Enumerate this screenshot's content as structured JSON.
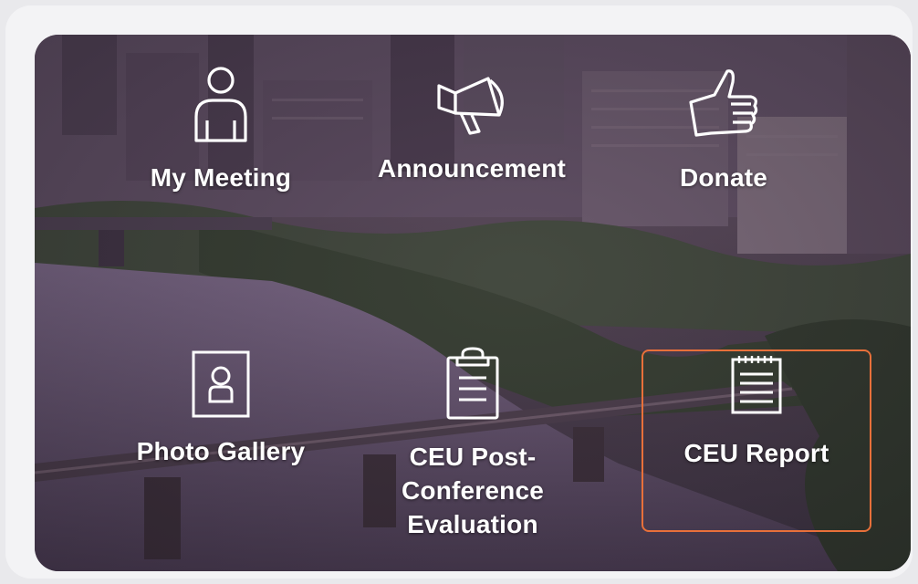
{
  "theme": {
    "accent": "#e8703a",
    "tile_text": "#ffffff"
  },
  "tiles": [
    {
      "id": "my-meeting",
      "label": "My Meeting",
      "icon": "person-icon"
    },
    {
      "id": "announcement",
      "label": "Announcement",
      "icon": "megaphone-icon"
    },
    {
      "id": "donate",
      "label": "Donate",
      "icon": "thumbs-up-icon"
    },
    {
      "id": "photo-gallery",
      "label": "Photo Gallery",
      "icon": "portrait-photo-icon"
    },
    {
      "id": "ceu-evaluation",
      "label": "CEU Post-\nConference\nEvaluation",
      "icon": "clipboard-icon"
    },
    {
      "id": "ceu-report",
      "label": "CEU Report",
      "icon": "notepad-icon",
      "selected": true
    }
  ]
}
